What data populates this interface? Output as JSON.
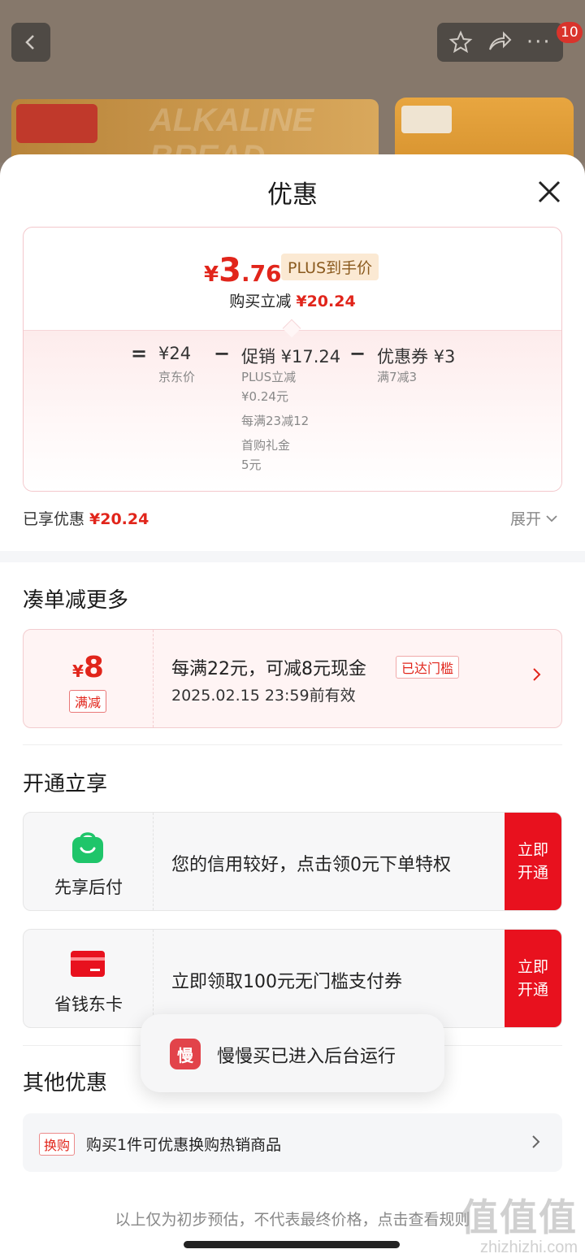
{
  "background": {
    "notification_count": "10",
    "banner_ghost_text": "ALKALINE BREAD"
  },
  "sheet": {
    "title": "优惠"
  },
  "price_card": {
    "currency": "¥",
    "final_int": "3",
    "final_dec": ".76",
    "plus_label": "PLUS到手价",
    "buy_label": "购买立减",
    "buy_amount": "¥20.24",
    "equals": "=",
    "minus": "−",
    "jd_price": "¥24",
    "jd_price_label": "京东价",
    "promo_title": "促销 ¥17.24",
    "promo_items": [
      "PLUS立减",
      "¥0.24元",
      "每满23减12",
      "首购礼金",
      "5元"
    ],
    "coupon_title": "优惠券 ¥3",
    "coupon_desc": "满7减3"
  },
  "enjoyed": {
    "label": "已享优惠",
    "amount": "¥20.24",
    "expand": "展开"
  },
  "sections": {
    "more": "凑单减更多",
    "open": "开通立享",
    "other": "其他优惠"
  },
  "coupon": {
    "currency": "¥",
    "amount": "8",
    "type": "满减",
    "main": "每满22元，可减8元现金",
    "tag": "已达门槛",
    "date": "2025.02.15 23:59前有效"
  },
  "open_cards": [
    {
      "name": "先享后付",
      "text": "您的信用较好，点击领0元下单特权",
      "button": "立即开通",
      "icon": "bag-icon",
      "color": "#1fc56a"
    },
    {
      "name": "省钱东卡",
      "text": "立即领取100元无门槛支付券",
      "button": "立即开通",
      "icon": "card-icon",
      "color": "#e8111e"
    }
  ],
  "toast": {
    "icon_char": "慢",
    "text": "慢慢买已进入后台运行"
  },
  "other": {
    "tag": "换购",
    "text": "购买1件可优惠换购热销商品"
  },
  "disclaimer": "以上仅为初步预估，不代表最终价格，点击查看规则",
  "watermark": {
    "big": "值值值",
    "small": "zhizhizhi.com"
  },
  "colors": {
    "accent": "#e1251b",
    "button_red": "#e8111e",
    "plus_gold": "#8a5a1e"
  }
}
